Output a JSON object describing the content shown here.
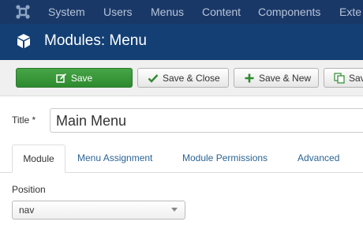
{
  "colors": {
    "navbar": "#1a3867",
    "header": "#133f74",
    "save_button": "#3c9a3c",
    "link": "#2a6496"
  },
  "navbar": {
    "logo_icon": "joomla-logo-icon",
    "items": [
      "System",
      "Users",
      "Menus",
      "Content",
      "Components",
      "Exte"
    ]
  },
  "header": {
    "icon": "cube-icon",
    "title": "Modules: Menu"
  },
  "toolbar": {
    "save_label": "Save",
    "save_close_label": "Save & Close",
    "save_new_label": "Save & New",
    "save_copy_label": "Sav"
  },
  "form": {
    "title_label": "Title *",
    "title_value": "Main Menu",
    "tabs": [
      "Module",
      "Menu Assignment",
      "Module Permissions",
      "Advanced"
    ],
    "active_tab": "Module",
    "position_label": "Position",
    "position_value": "nav"
  }
}
